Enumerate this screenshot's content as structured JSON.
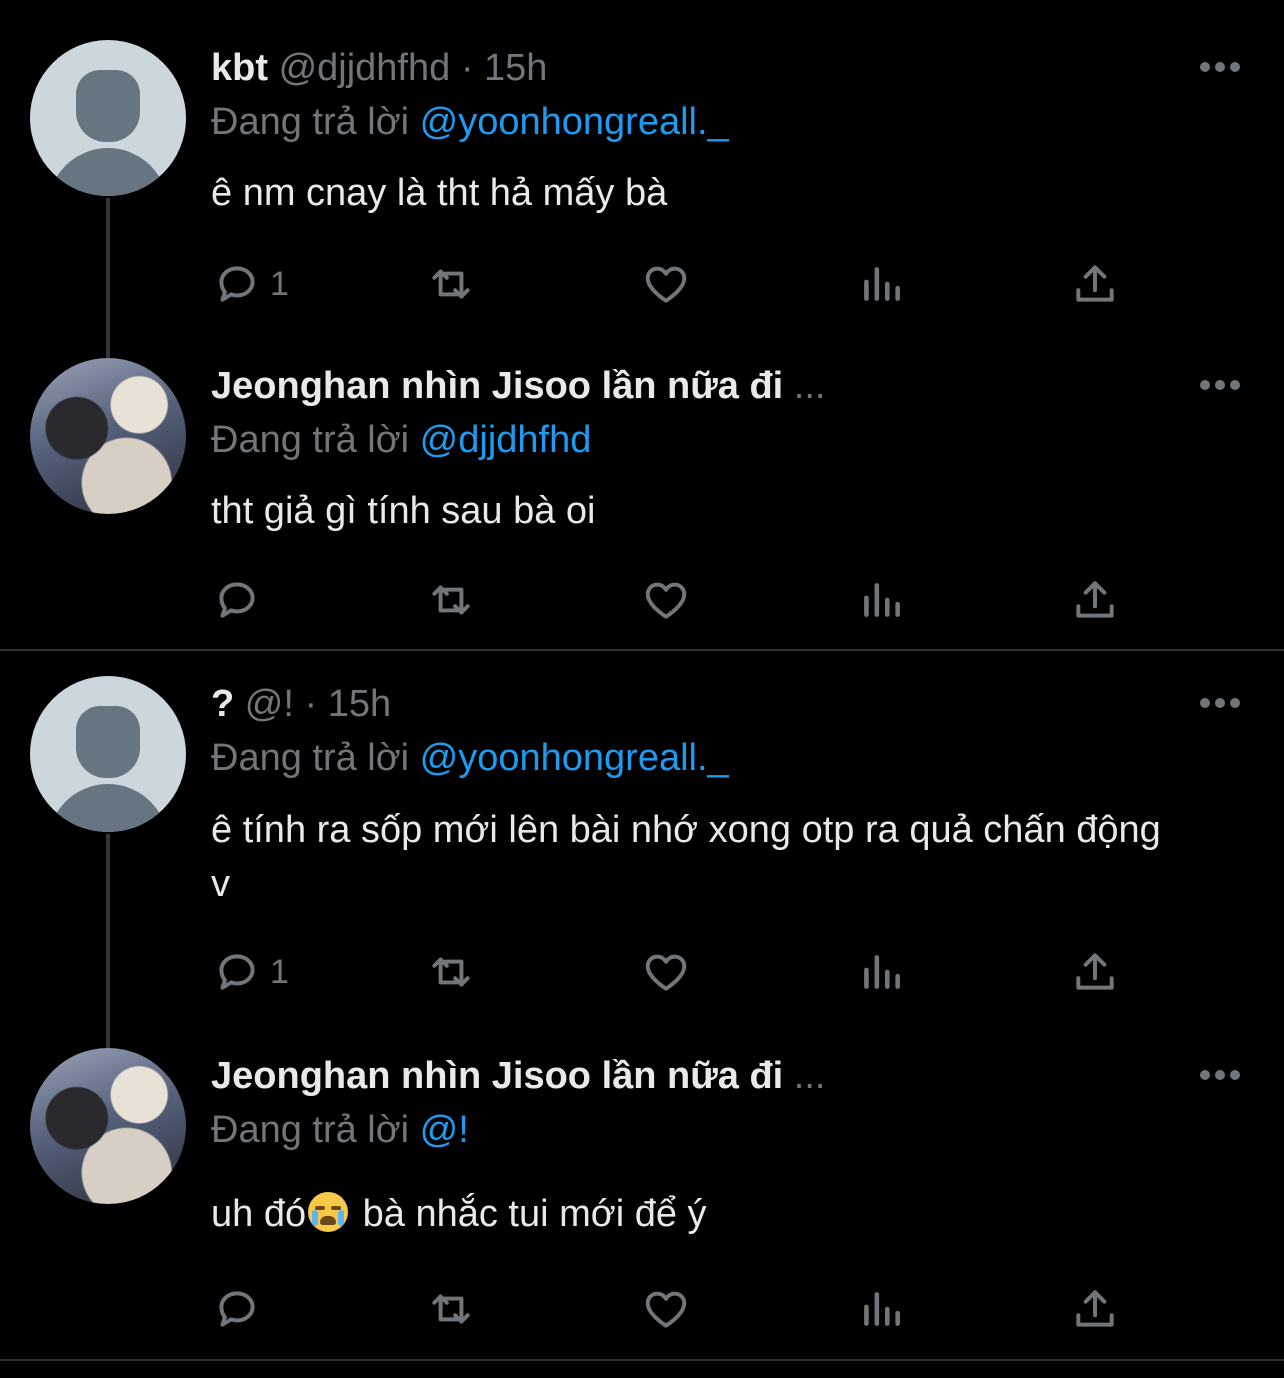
{
  "colors": {
    "background": "#000000",
    "text": "#e7e9ea",
    "muted": "#71767b",
    "mention": "#1d9bf0",
    "divider": "#2f3336"
  },
  "icons": {
    "reply": "reply-icon",
    "retweet": "retweet-icon",
    "like": "heart-icon",
    "views": "views-icon",
    "share": "share-icon",
    "more": "more-icon"
  },
  "tweets": [
    {
      "name": "kbt",
      "handle": "@djjdhfhd",
      "sep": "·",
      "time": "15h",
      "reply_prefix": "Đang trả lời",
      "reply_to": "@yoonhongreall._",
      "text": "ê nm cnay là tht hả mấy bà",
      "reply_count": "1"
    },
    {
      "name": "Jeonghan nhìn Jisoo lần nữa đi",
      "ellipsis": "...",
      "reply_prefix": "Đang trả lời",
      "reply_to": "@djjdhfhd",
      "text": "tht giả gì tính sau bà oi",
      "reply_count": ""
    },
    {
      "name": "?",
      "handle": "@!",
      "sep": "·",
      "time": "15h",
      "reply_prefix": "Đang trả lời",
      "reply_to": "@yoonhongreall._",
      "text": "ê tính ra sốp mới lên bài nhớ xong otp ra quả chấn động v",
      "reply_count": "1"
    },
    {
      "name": "Jeonghan nhìn Jisoo lần nữa đi",
      "ellipsis": "...",
      "reply_prefix": "Đang trả lời",
      "reply_to": "@!",
      "text_before": "uh đó",
      "text_after": " bà nhắc tui mới để ý",
      "reply_count": ""
    }
  ]
}
